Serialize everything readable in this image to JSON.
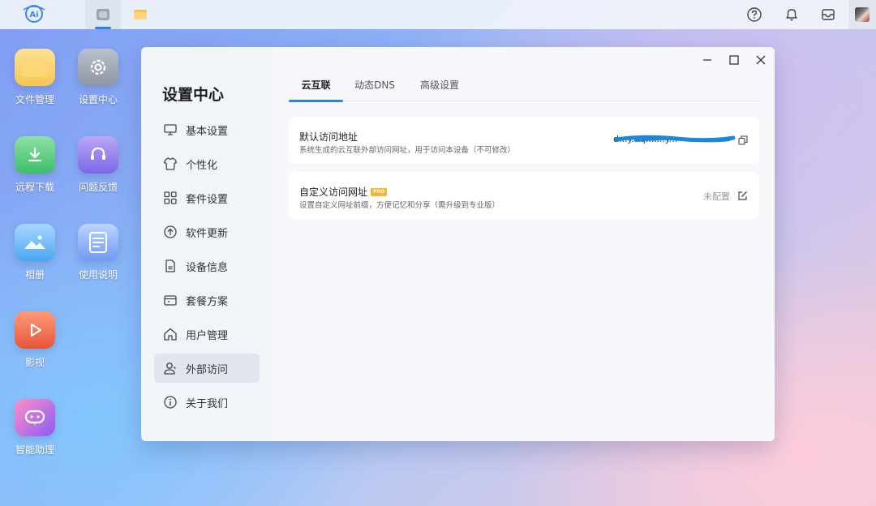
{
  "topbar": {
    "logo_text": "Ai",
    "tabs": [
      {
        "icon": "settings-app-icon",
        "active": true
      },
      {
        "icon": "folder-app-icon",
        "active": false
      }
    ],
    "right_icons": [
      "help-icon",
      "bell-icon",
      "inbox-icon"
    ],
    "avatar": "user-avatar"
  },
  "desktop": {
    "icons": [
      {
        "label": "文件管理",
        "icon": "folder-icon"
      },
      {
        "label": "设置中心",
        "icon": "gear-icon"
      },
      {
        "label": "远程下载",
        "icon": "download-icon"
      },
      {
        "label": "问题反馈",
        "icon": "headset-icon"
      },
      {
        "label": "相册",
        "icon": "photo-icon"
      },
      {
        "label": "使用说明",
        "icon": "document-icon"
      },
      {
        "label": "影视",
        "icon": "play-icon"
      },
      {
        "label": "智能助理",
        "icon": "chat-bot-icon"
      }
    ]
  },
  "window": {
    "sidebar_title": "设置中心",
    "nav": [
      {
        "label": "基本设置",
        "icon": "monitor-icon",
        "active": false
      },
      {
        "label": "个性化",
        "icon": "shirt-icon",
        "active": false
      },
      {
        "label": "套件设置",
        "icon": "grid-icon",
        "active": false
      },
      {
        "label": "软件更新",
        "icon": "arrow-up-circle-icon",
        "active": false
      },
      {
        "label": "设备信息",
        "icon": "file-icon",
        "active": false
      },
      {
        "label": "套餐方案",
        "icon": "package-icon",
        "active": false
      },
      {
        "label": "用户管理",
        "icon": "home-icon",
        "active": false
      },
      {
        "label": "外部访问",
        "icon": "user-icon",
        "active": true
      },
      {
        "label": "关于我们",
        "icon": "info-icon",
        "active": false
      }
    ],
    "tabs": [
      {
        "label": "云互联",
        "active": true
      },
      {
        "label": "动态DNS",
        "active": false
      },
      {
        "label": "高级设置",
        "active": false
      }
    ],
    "cards": {
      "default_address": {
        "title": "默认访问地址",
        "desc": "系统生成的云互联外部访问网址，用于访问本设备（不可修改）",
        "value": "d...y...q...l...y..."
      },
      "custom_address": {
        "title": "自定义访问网址",
        "badge": "PRO",
        "desc": "设置自定义网址前缀，方便记忆和分享（需升级到专业版）",
        "status": "未配置"
      }
    }
  },
  "colors": {
    "accent": "#2f7ef6",
    "pro_badge": "#f1b733"
  }
}
